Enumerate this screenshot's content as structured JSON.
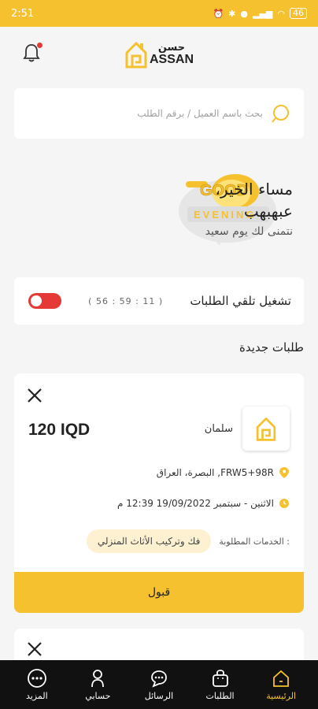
{
  "status_bar": {
    "time": "2:51",
    "battery": "46"
  },
  "header": {
    "logo_ar": "حسن",
    "logo_en": "ASSAN"
  },
  "search": {
    "placeholder": "بحث باسم العميل / برقم الطلب"
  },
  "greeting": {
    "title": "مساء الخير،",
    "name": "عبهبهب",
    "subtitle": "نتمنى لك يوم سعيد",
    "badge_good": "GOOD",
    "badge_evening": "EVENING"
  },
  "toggle_card": {
    "label": "تشغيل تلقي الطلبات",
    "timer": "( 56 : 59 : 11 )",
    "enabled": false
  },
  "section_title": "طلبات جديدة",
  "order": {
    "price": "120 IQD",
    "customer": "سلمان",
    "address": "البصرة، العراق ,FRW5+98R",
    "datetime": "الاثنين - سبتمبر 19/09/2022 12:39 م",
    "services_label": "الخدمات المطلوبة :",
    "service": "فك وتركيب الأثاث المنزلي",
    "accept_label": "قبول"
  },
  "bottom_nav": [
    {
      "label": "الرئيسية",
      "icon": "home-icon",
      "active": true
    },
    {
      "label": "الطلبات",
      "icon": "bag-icon",
      "active": false
    },
    {
      "label": "الرسائل",
      "icon": "chat-icon",
      "active": false
    },
    {
      "label": "حسابي",
      "icon": "user-icon",
      "active": false
    },
    {
      "label": "المزيد",
      "icon": "more-icon",
      "active": false
    }
  ],
  "colors": {
    "accent": "#f5c12e",
    "toggle_off": "#e53935",
    "nav_bg": "#111111"
  }
}
